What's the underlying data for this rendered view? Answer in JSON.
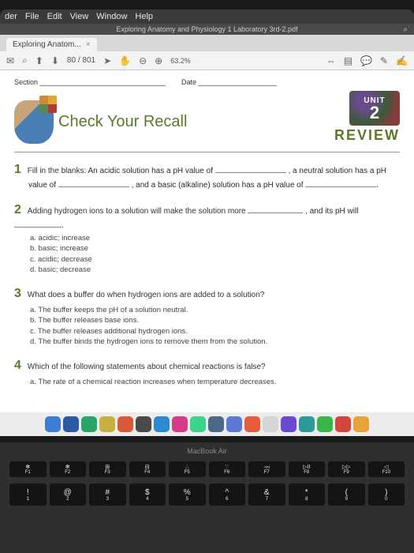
{
  "menubar": [
    "der",
    "File",
    "Edit",
    "View",
    "Window",
    "Help"
  ],
  "window_title": "Exploring Anatomy and Physiology 1 Laboratory 3rd-2.pdf",
  "tab": {
    "label": "Exploring Anatom...",
    "close": "×"
  },
  "toolbar": {
    "page_current": "80",
    "page_sep": "/",
    "page_total": "801",
    "zoom": "63.2%"
  },
  "doc": {
    "section_label": "Section",
    "date_label": "Date",
    "title": "Check Your Recall",
    "unit_label": "UNIT",
    "unit_number": "2",
    "review": "REVIEW",
    "q1": {
      "num": "1",
      "lead": "Fill in the blanks:",
      "t1": "An acidic solution has a pH value of",
      "t2": ", a neutral solution has a pH",
      "t3": "value of",
      "t4": ", and a basic (alkaline) solution has a pH value of"
    },
    "q2": {
      "num": "2",
      "t1": "Adding hydrogen ions to a solution will make the solution more",
      "t2": ", and its pH will",
      "opts": [
        "a.  acidic; increase",
        "b.  basic; increase",
        "c.  acidic; decrease",
        "d.  basic; decrease"
      ]
    },
    "q3": {
      "num": "3",
      "t1": "What does a buffer do when hydrogen ions are added to a solution?",
      "opts": [
        "a.  The buffer keeps the pH of a solution neutral.",
        "b.  The buffer releases base ions.",
        "c.  The buffer releases additional hydrogen ions.",
        "d.  The buffer binds the hydrogen ions to remove them from the solution."
      ]
    },
    "q4": {
      "num": "4",
      "t1": "Which of the following statements about chemical reactions is false?",
      "opts": [
        "a.  The rate of a chemical reaction increases when temperature decreases."
      ]
    }
  },
  "laptop_label": "MacBook Air",
  "fnrow": [
    {
      "top": "✻",
      "bot": "F1"
    },
    {
      "top": "✻",
      "bot": "F2"
    },
    {
      "top": "⊞",
      "bot": "F3"
    },
    {
      "top": "⊟",
      "bot": "F4"
    },
    {
      "top": "∴",
      "bot": "F5"
    },
    {
      "top": "∵",
      "bot": "F6"
    },
    {
      "top": "◃◃",
      "bot": "F7"
    },
    {
      "top": "▷II",
      "bot": "F8"
    },
    {
      "top": "▷▷",
      "bot": "F9"
    },
    {
      "top": "◁",
      "bot": "F10"
    }
  ],
  "numrow": [
    {
      "top": "!",
      "bot": "1"
    },
    {
      "top": "@",
      "bot": "2"
    },
    {
      "top": "#",
      "bot": "3"
    },
    {
      "top": "$",
      "bot": "4"
    },
    {
      "top": "%",
      "bot": "5"
    },
    {
      "top": "^",
      "bot": "6"
    },
    {
      "top": "&",
      "bot": "7"
    },
    {
      "top": "*",
      "bot": "8"
    },
    {
      "top": "(",
      "bot": "9"
    },
    {
      "top": ")",
      "bot": "0"
    }
  ],
  "dock_colors": [
    "#3a7fd5",
    "#2a5aa5",
    "#2aa56a",
    "#c8b040",
    "#d85a3a",
    "#4a4a4a",
    "#2a8ad5",
    "#d83a8a",
    "#3ad58a",
    "#4a6a8a",
    "#5a7ad5",
    "#e85a3a",
    "#d5d5d5",
    "#6a4ad5",
    "#2a9a9a",
    "#3ab54a",
    "#d5453a",
    "#e8a23a"
  ]
}
